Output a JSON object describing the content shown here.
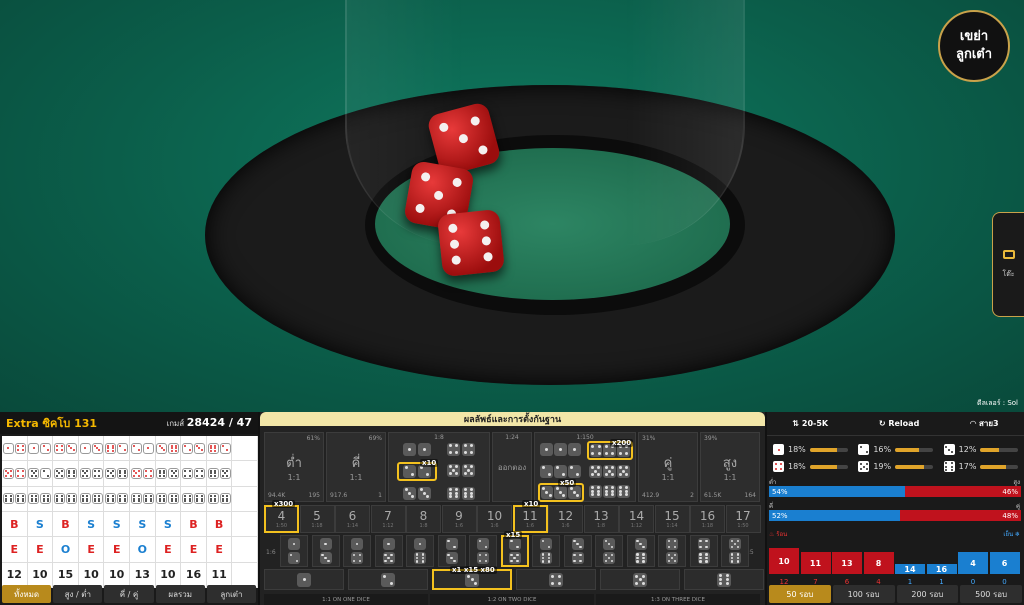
{
  "video": {
    "shake_button": "เขย่า ลูกเต๋า",
    "side_tab_label": "โต๊ะ",
    "dealer_label": "ดีลเลอร์ : Sol"
  },
  "left_panel": {
    "title": "Extra ซิคโบ 131",
    "game_label": "เกมส์",
    "game_number": "28424 / 47",
    "road": {
      "dice_rows": [
        [
          [
            1,
            4,
            "r"
          ],
          [
            1,
            2,
            "r"
          ],
          [
            4,
            3,
            "r"
          ],
          [
            1,
            3,
            "r"
          ],
          [
            6,
            2,
            "r"
          ],
          [
            2,
            1,
            "r"
          ],
          [
            3,
            6,
            "r"
          ],
          [
            2,
            3,
            "r"
          ],
          [
            6,
            2,
            "r"
          ]
        ],
        [
          [
            5,
            4,
            "r"
          ],
          [
            5,
            2,
            ""
          ],
          [
            5,
            6,
            ""
          ],
          [
            5,
            4,
            ""
          ],
          [
            5,
            6,
            ""
          ],
          [
            5,
            4,
            "r"
          ],
          [
            6,
            5,
            ""
          ],
          [
            4,
            4,
            ""
          ],
          [
            6,
            5,
            ""
          ]
        ],
        [
          [
            6,
            6,
            ""
          ],
          [
            6,
            6,
            ""
          ],
          [
            6,
            6,
            ""
          ],
          [
            6,
            6,
            ""
          ],
          [
            6,
            6,
            ""
          ],
          [
            6,
            6,
            ""
          ],
          [
            6,
            6,
            ""
          ],
          [
            6,
            6,
            ""
          ],
          [
            6,
            6,
            ""
          ]
        ]
      ],
      "bs_row": [
        "B",
        "S",
        "B",
        "S",
        "S",
        "S",
        "S",
        "B",
        "B"
      ],
      "oe_row": [
        "E",
        "E",
        "O",
        "E",
        "E",
        "O",
        "E",
        "E",
        "E"
      ],
      "totals_row": [
        "12",
        "10",
        "15",
        "10",
        "10",
        "13",
        "10",
        "16",
        "11"
      ]
    },
    "tabs": [
      "ทั้งหมด",
      "สูง / ต่ำ",
      "คี่ / คู่",
      "ผลรวม",
      "ลูกเต๋า"
    ]
  },
  "board": {
    "header": "ผลลัพธ์และการตั้งกันฐาน",
    "low": {
      "label": "ต่ำ",
      "odds": "1:1",
      "pct": "61%",
      "amount": "94.4K",
      "players": "195"
    },
    "odd": {
      "label": "คี่",
      "odds": "1:1",
      "pct": "69%",
      "amount": "917.6",
      "players": "1"
    },
    "even": {
      "label": "คู่",
      "odds": "1:1",
      "pct": "31%",
      "amount": "412.9",
      "players": "2"
    },
    "high": {
      "label": "สูง",
      "odds": "1:1",
      "pct": "39%",
      "amount": "61.5K",
      "players": "164"
    },
    "any_triple": {
      "label": "ออกตอง",
      "odds": "1:24"
    },
    "double_odds": "1:8",
    "triple_odds": "1:150",
    "multipliers": {
      "double": "x10",
      "triple": "x200",
      "triple2": "x50",
      "num4": "x300",
      "num11": "x10",
      "pair": "x15",
      "single": "x1 x15 x80"
    },
    "numbers": [
      {
        "n": "4",
        "o": "1:50"
      },
      {
        "n": "5",
        "o": "1:18"
      },
      {
        "n": "6",
        "o": "1:14"
      },
      {
        "n": "7",
        "o": "1:12"
      },
      {
        "n": "8",
        "o": "1:8"
      },
      {
        "n": "9",
        "o": "1:6"
      },
      {
        "n": "10",
        "o": "1:6"
      },
      {
        "n": "11",
        "o": "1:6"
      },
      {
        "n": "12",
        "o": "1:6"
      },
      {
        "n": "13",
        "o": "1:8"
      },
      {
        "n": "14",
        "o": "1:12"
      },
      {
        "n": "15",
        "o": "1:14"
      },
      {
        "n": "16",
        "o": "1:18"
      },
      {
        "n": "17",
        "o": "1:50"
      }
    ],
    "pair_side_odds": "1:6",
    "pair_side_odds_right": "1:5",
    "footer": [
      "1:1 ON ONE DICE",
      "1:2 ON TWO DICE",
      "1:3 ON THREE DICE"
    ]
  },
  "right_panel": {
    "limit": "20-5K",
    "reload": "Reload",
    "signal": "สาย3",
    "face_stats": [
      {
        "face": 1,
        "pct": "18%",
        "fill": 0.18
      },
      {
        "face": 2,
        "pct": "16%",
        "fill": 0.16
      },
      {
        "face": 3,
        "pct": "12%",
        "fill": 0.12
      },
      {
        "face": 4,
        "pct": "18%",
        "fill": 0.18
      },
      {
        "face": 5,
        "pct": "19%",
        "fill": 0.19
      },
      {
        "face": 6,
        "pct": "17%",
        "fill": 0.17
      }
    ],
    "low_label": "ต่ำ",
    "high_label": "สูง",
    "low_high": {
      "left": "54%",
      "right": "46%",
      "left_frac": 0.54
    },
    "odd_label": "คี่",
    "even_label": "คู่",
    "odd_even": {
      "left": "52%",
      "right": "48%",
      "left_frac": 0.52
    },
    "hot_label": "ร้อน",
    "cold_label": "เย็น",
    "hist": [
      {
        "v": "10",
        "c": "12",
        "color": "#c0121d"
      },
      {
        "v": "11",
        "c": "7",
        "color": "#c0121d"
      },
      {
        "v": "13",
        "c": "6",
        "color": "#c0121d"
      },
      {
        "v": "8",
        "c": "4",
        "color": "#c0121d"
      },
      {
        "v": "14",
        "c": "1",
        "color": "#1a7fd0"
      },
      {
        "v": "16",
        "c": "1",
        "color": "#1a7fd0"
      },
      {
        "v": "4",
        "c": "0",
        "color": "#1a7fd0"
      },
      {
        "v": "6",
        "c": "0",
        "color": "#1a7fd0"
      }
    ],
    "tabs": [
      "50 รอบ",
      "100 รอบ",
      "200 รอบ",
      "500 รอบ"
    ]
  }
}
